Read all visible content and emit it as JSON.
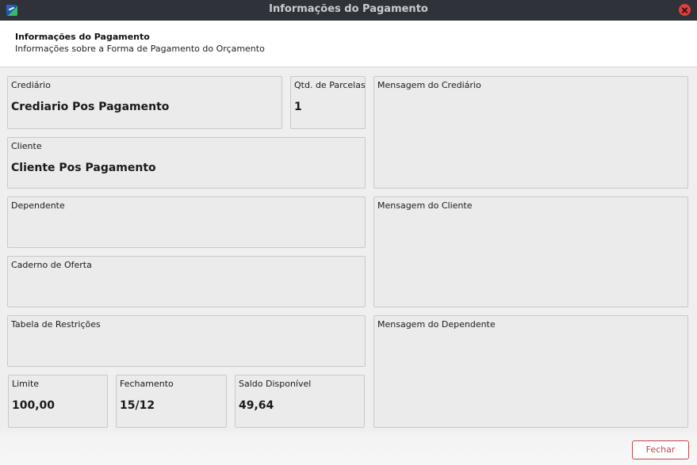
{
  "window": {
    "title": "Informações do Pagamento",
    "app_icon": "app-logo-icon",
    "close_icon": "close-icon"
  },
  "header": {
    "title": "Informações do Pagamento",
    "subtitle": "Informações sobre a Forma de Pagamento do Orçamento"
  },
  "fields": {
    "crediario": {
      "label": "Crediário",
      "value": "Crediario Pos Pagamento"
    },
    "qtd_parcelas": {
      "label": "Qtd. de Parcelas",
      "value": "1"
    },
    "cliente": {
      "label": "Cliente",
      "value": "Cliente Pos Pagamento"
    },
    "dependente": {
      "label": "Dependente",
      "value": ""
    },
    "caderno_oferta": {
      "label": "Caderno de Oferta",
      "value": ""
    },
    "tabela_restricoes": {
      "label": "Tabela de Restrições",
      "value": ""
    },
    "limite": {
      "label": "Limite",
      "value": "100,00"
    },
    "fechamento": {
      "label": "Fechamento",
      "value": "15/12"
    },
    "saldo_disponivel": {
      "label": "Saldo Disponível",
      "value": "49,64"
    },
    "mensagem_crediario": {
      "label": "Mensagem do Crediário",
      "value": ""
    },
    "mensagem_cliente": {
      "label": "Mensagem do Cliente",
      "value": ""
    },
    "mensagem_dependente": {
      "label": "Mensagem do Dependente",
      "value": ""
    }
  },
  "footer": {
    "fechar_label": "Fechar"
  },
  "colors": {
    "titlebar": "#2f3238",
    "close_button": "#e0403e",
    "accent_button_border": "#c0464a",
    "field_background": "#ebebeb"
  }
}
